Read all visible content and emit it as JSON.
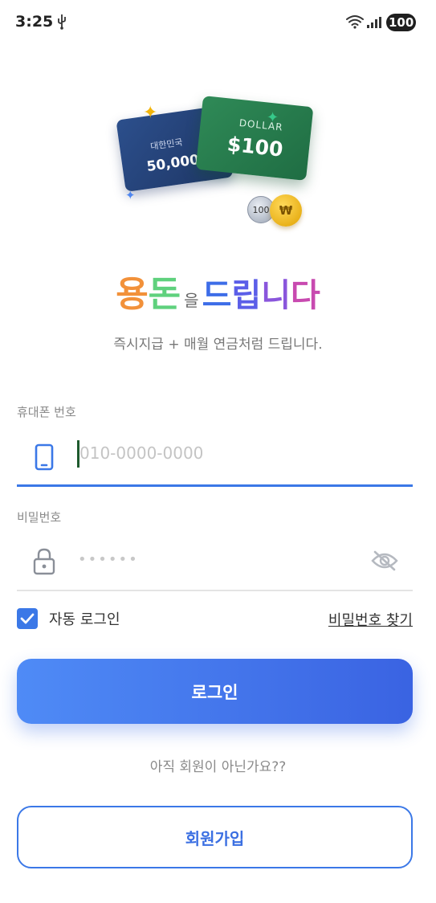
{
  "status_bar": {
    "time": "3:25",
    "battery": "100"
  },
  "hero": {
    "krw_card": {
      "country": "대한민국",
      "amount": "50,000원"
    },
    "usd_card": {
      "currency": "DOLLAR",
      "amount": "$100"
    },
    "silver_coin": "100",
    "gold_coin": "₩"
  },
  "headline": {
    "part1": "용",
    "part2": "돈",
    "particle": "을",
    "part3": "드",
    "part4": "립",
    "part5": "니",
    "part6": "다"
  },
  "subtitle": "즉시지급 + 매월 연금처럼 드립니다.",
  "form": {
    "phone_label": "휴대폰 번호",
    "phone_placeholder": "010-0000-0000",
    "password_label": "비밀번호",
    "password_placeholder": "••••••",
    "auto_login_label": "자동 로그인",
    "find_password": "비밀번호 찾기"
  },
  "buttons": {
    "login": "로그인",
    "signup": "회원가입"
  },
  "not_member_text": "아직 회원이 아닌가요??",
  "colors": {
    "primary": "#3b78e7",
    "headline_orange": "#f2913a",
    "headline_green": "#5fd17d"
  }
}
